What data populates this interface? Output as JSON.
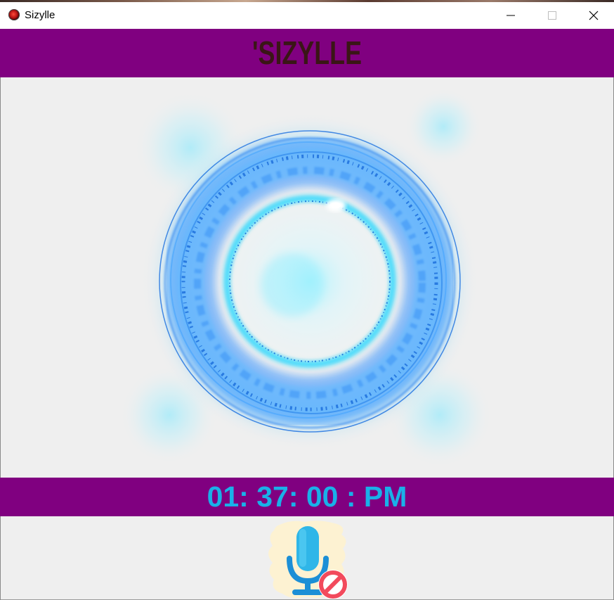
{
  "window": {
    "title": "Sizylle",
    "controls": {
      "minimize": "minimize-icon",
      "maximize": "maximize-icon",
      "close": "close-icon"
    }
  },
  "header": {
    "brand": "'SIZYLLE"
  },
  "visualizer": {
    "icon": "energy-orb"
  },
  "clock": {
    "time": "01: 37: 00 : PM"
  },
  "mic": {
    "icon": "microphone-muted-icon"
  },
  "colors": {
    "accent_bar": "#800080",
    "clock_text": "#1ab0e8",
    "brand_text": "#3a1616",
    "orb": "#1e90ff"
  }
}
